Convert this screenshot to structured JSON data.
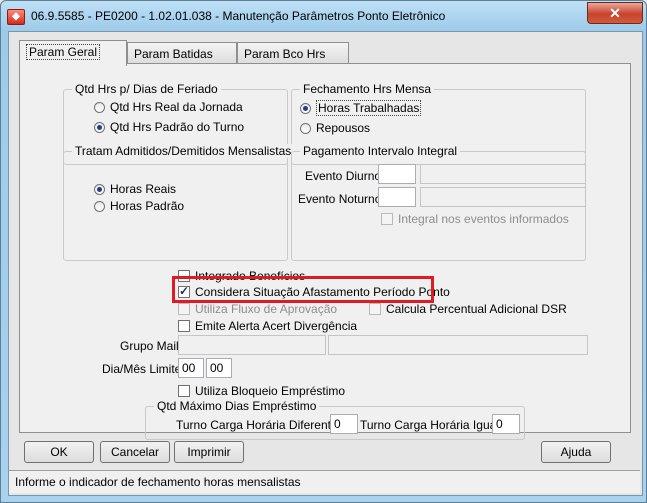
{
  "window": {
    "title": "06.9.5585 - PE0200 - 1.02.01.038 - Manutenção Parâmetros Ponto Eletrônico",
    "close_label": "✕"
  },
  "tabs": [
    {
      "label": "Param Geral",
      "active": true
    },
    {
      "label": "Param Batidas",
      "active": false
    },
    {
      "label": "Param Bco Hrs",
      "active": false
    }
  ],
  "qtd_hrs_feriado": {
    "title": "Qtd Hrs p/ Dias de Feriado",
    "options": [
      {
        "label": "Qtd Hrs Real da Jornada",
        "selected": false
      },
      {
        "label": "Qtd Hrs Padrão do Turno",
        "selected": true
      }
    ]
  },
  "fechamento": {
    "title": "Fechamento Hrs Mensa",
    "options": [
      {
        "label": "Horas Trabalhadas",
        "selected": true
      },
      {
        "label": "Repousos",
        "selected": false
      }
    ]
  },
  "admitidos": {
    "title": "Tratam Admitidos/Demitidos Mensalistas",
    "options": [
      {
        "label": "Horas Reais",
        "selected": true
      },
      {
        "label": "Horas Padrão",
        "selected": false
      }
    ]
  },
  "pagamento": {
    "title": "Pagamento Intervalo Integral",
    "evento_diurno_label": "Evento Diurno:",
    "evento_diurno_value": "",
    "evento_noturno_label": "Evento Noturno:",
    "evento_noturno_value": "",
    "integral_label": "Integral nos eventos informados"
  },
  "checks": {
    "integrado_beneficios": "Integrado Benefícios",
    "considera_afastamento": "Considera Situação Afastamento Período Ponto",
    "utiliza_fluxo": "Utiliza Fluxo de Aprovação",
    "calcula_percentual": "Calcula Percentual Adicional DSR",
    "emite_alerta": "Emite Alerta Acert Divergência",
    "utiliza_bloqueio": "Utiliza Bloqueio Empréstimo"
  },
  "grupo_mail": {
    "label": "Grupo Mail:",
    "value1": "",
    "value2": ""
  },
  "dia_mes_limite": {
    "label": "Dia/Mês Limite:",
    "dia": "00",
    "mes": "00"
  },
  "qtd_maximo": {
    "title": "Qtd Máximo Dias Empréstimo",
    "turno_diferente_label": "Turno Carga Horária Diferente:",
    "turno_diferente_value": "0",
    "turno_igual_label": "Turno Carga Horária Igual:",
    "turno_igual_value": "0"
  },
  "buttons": {
    "ok": "OK",
    "cancelar": "Cancelar",
    "imprimir": "Imprimir",
    "ajuda": "Ajuda"
  },
  "status_text": "Informe o indicador de fechamento horas mensalistas",
  "colors": {
    "highlight": "#e01b22",
    "radio_selected": "#1f3f8a"
  }
}
